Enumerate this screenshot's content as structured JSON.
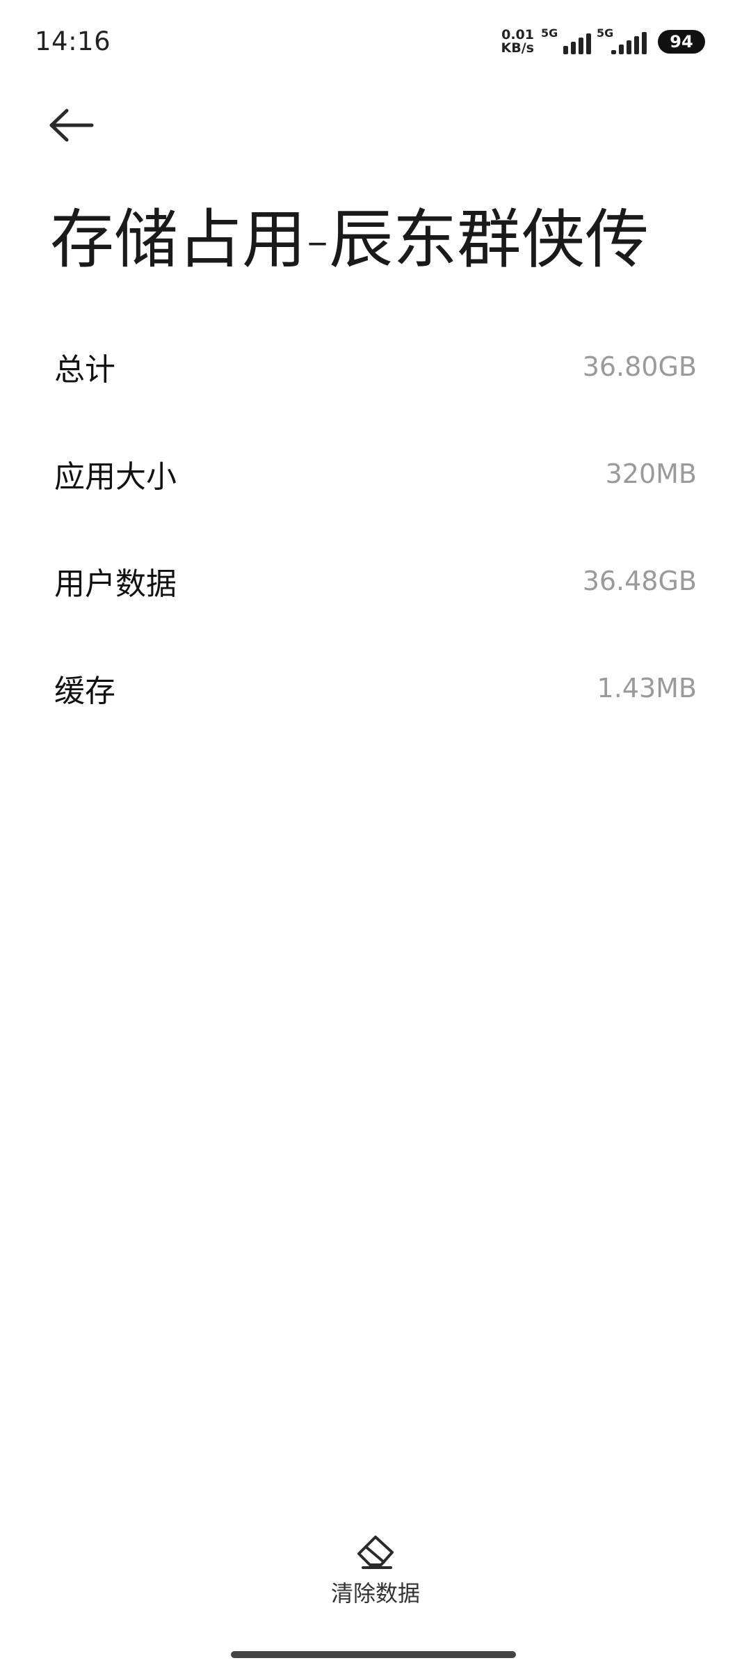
{
  "status_bar": {
    "time": "14:16",
    "net_speed_value": "0.01",
    "net_speed_unit": "KB/s",
    "sim1_label": "5G",
    "sim2_label": "5G",
    "battery": "94"
  },
  "header": {
    "back_icon": "arrow-left-icon",
    "title": "存储占用-辰东群侠传"
  },
  "storage_rows": [
    {
      "label": "总计",
      "value": "36.80GB"
    },
    {
      "label": "应用大小",
      "value": "320MB"
    },
    {
      "label": "用户数据",
      "value": "36.48GB"
    },
    {
      "label": "缓存",
      "value": "1.43MB"
    }
  ],
  "bottom_action": {
    "icon": "eraser-icon",
    "label": "清除数据"
  }
}
